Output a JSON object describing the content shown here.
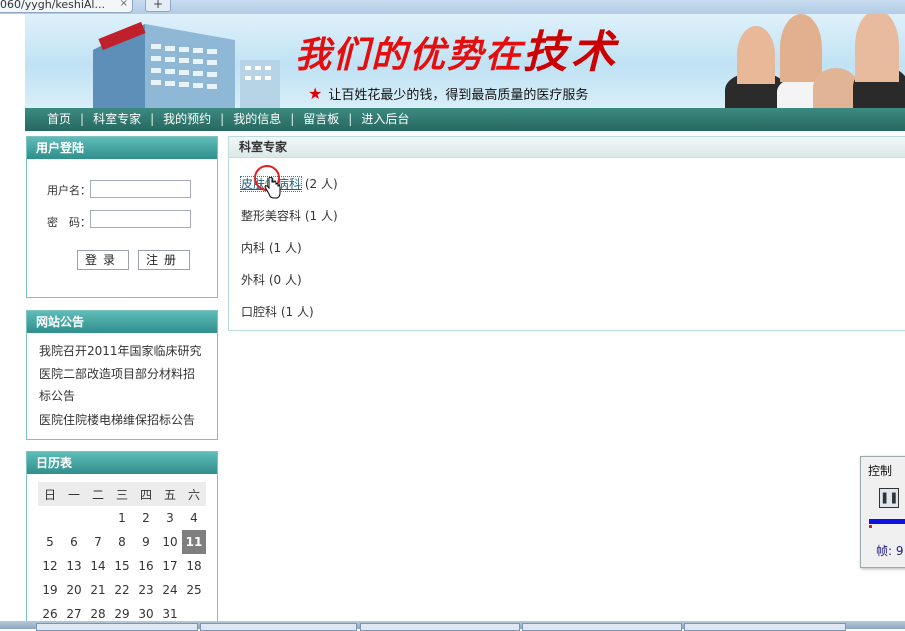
{
  "browser": {
    "tab_title": "060/yygh/keshiAl...",
    "tab_close": "×",
    "new_tab": "+"
  },
  "banner": {
    "slogan": "我们的优势在",
    "slogan_emphasis": "技术",
    "subline": "让百姓花最少的钱，得到最高质量的医疗服务",
    "star": "★"
  },
  "nav": {
    "items": [
      "首页",
      "科室专家",
      "我的预约",
      "我的信息",
      "留言板",
      "进入后台"
    ],
    "separator": "|"
  },
  "login": {
    "title": "用户登陆",
    "username_label": "用户名：",
    "password_label": "密　码：",
    "login_button": "登录",
    "register_button": "注册"
  },
  "announcements": {
    "title": "网站公告",
    "items": [
      "我院召开2011年国家临床研究",
      "医院二部改造项目部分材料招",
      "标公告",
      "医院住院楼电梯维保招标公告"
    ]
  },
  "calendar": {
    "title": "日历表",
    "weekdays": [
      "日",
      "一",
      "二",
      "三",
      "四",
      "五",
      "六"
    ],
    "rows": [
      [
        "",
        "",
        "",
        "1",
        "2",
        "3",
        "4"
      ],
      [
        "5",
        "6",
        "7",
        "8",
        "9",
        "10",
        "11"
      ],
      [
        "12",
        "13",
        "14",
        "15",
        "16",
        "17",
        "18"
      ],
      [
        "19",
        "20",
        "21",
        "22",
        "23",
        "24",
        "25"
      ],
      [
        "26",
        "27",
        "28",
        "29",
        "30",
        "31",
        ""
      ]
    ],
    "today": "11"
  },
  "departments": {
    "title": "科室专家",
    "items": [
      {
        "name": "皮肤性病科",
        "count": "(2 人)"
      },
      {
        "name": "整形美容科",
        "count": "(1 人)"
      },
      {
        "name": "内科",
        "count": "(1 人)"
      },
      {
        "name": "外科",
        "count": "(0 人)"
      },
      {
        "name": "口腔科",
        "count": "(1 人)"
      }
    ]
  },
  "control": {
    "title": "控制",
    "pause_icon": "pause-icon",
    "frames_label": "帧: 9"
  },
  "colors": {
    "nav_bg": "#2f7a70",
    "panel_header": "#3fa3a0",
    "slogan_red": "#e50d0d"
  }
}
